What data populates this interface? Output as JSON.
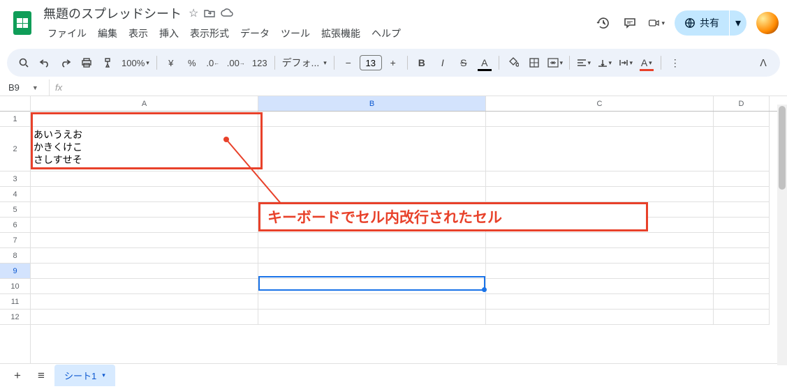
{
  "header": {
    "doc_title": "無題のスプレッドシート",
    "menus": [
      "ファイル",
      "編集",
      "表示",
      "挿入",
      "表示形式",
      "データ",
      "ツール",
      "拡張機能",
      "ヘルプ"
    ],
    "share_label": "共有"
  },
  "toolbar": {
    "zoom": "100%",
    "currency": "¥",
    "percent": "%",
    "dec_dec": ".0",
    "inc_dec": ".00",
    "num_fmt": "123",
    "font": "デフォ...",
    "font_size": "13"
  },
  "namebox": {
    "value": "B9",
    "fx": "fx"
  },
  "columns": [
    "A",
    "B",
    "C",
    "D"
  ],
  "rows": [
    "1",
    "2",
    "3",
    "4",
    "5",
    "6",
    "7",
    "8",
    "9",
    "10",
    "11",
    "12"
  ],
  "cells": {
    "A2": "あいうえお\nかきくけこ\nさしすせそ"
  },
  "annotation": {
    "text": "キーボードでセル内改行されたセル"
  },
  "footer": {
    "sheet_tab": "シート1"
  },
  "colors": {
    "accent": "#1a73e8",
    "annot": "#e8412a",
    "share_bg": "#c2e7ff",
    "logo": "#0f9d58"
  }
}
